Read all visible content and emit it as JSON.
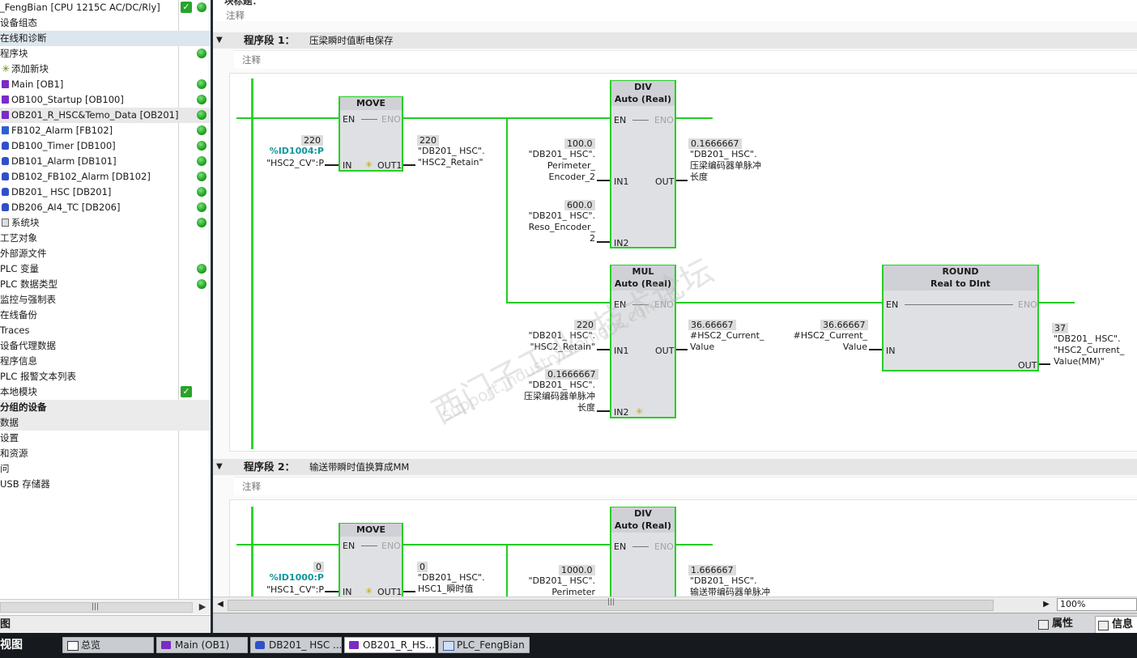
{
  "project_tree": {
    "items": [
      {
        "label": "_FengBian [CPU 1215C AC/DC/Rly]",
        "icon": "none",
        "indent": 0,
        "status": "check-dot"
      },
      {
        "label": "设备组态",
        "icon": "none",
        "indent": 0,
        "status": ""
      },
      {
        "label": "在线和诊断",
        "icon": "none",
        "indent": 0,
        "status": "",
        "selected": true
      },
      {
        "label": "程序块",
        "icon": "none",
        "indent": 0,
        "status": "dot"
      },
      {
        "label": "添加新块",
        "icon": "add",
        "indent": 1,
        "status": ""
      },
      {
        "label": "Main [OB1]",
        "icon": "ob",
        "indent": 1,
        "status": "dot"
      },
      {
        "label": "OB100_Startup [OB100]",
        "icon": "ob",
        "indent": 1,
        "status": "dot"
      },
      {
        "label": "OB201_R_HSC&Temo_Data [OB201]",
        "icon": "ob",
        "indent": 1,
        "status": "dot",
        "hover": true
      },
      {
        "label": "FB102_Alarm [FB102]",
        "icon": "fb",
        "indent": 1,
        "status": "dot"
      },
      {
        "label": "DB100_Timer [DB100]",
        "icon": "db",
        "indent": 1,
        "status": "dot"
      },
      {
        "label": "DB101_Alarm [DB101]",
        "icon": "db",
        "indent": 1,
        "status": "dot"
      },
      {
        "label": "DB102_FB102_Alarm [DB102]",
        "icon": "db",
        "indent": 1,
        "status": "dot"
      },
      {
        "label": "DB201_ HSC [DB201]",
        "icon": "db",
        "indent": 1,
        "status": "dot"
      },
      {
        "label": "DB206_AI4_TC [DB206]",
        "icon": "db",
        "indent": 1,
        "status": "dot"
      },
      {
        "label": "系统块",
        "icon": "sys",
        "indent": 1,
        "status": "dot"
      },
      {
        "label": "工艺对象",
        "icon": "none",
        "indent": 0,
        "status": ""
      },
      {
        "label": "外部源文件",
        "icon": "none",
        "indent": 0,
        "status": ""
      },
      {
        "label": "PLC 变量",
        "icon": "none",
        "indent": 0,
        "status": "dot"
      },
      {
        "label": "PLC 数据类型",
        "icon": "none",
        "indent": 0,
        "status": "dot"
      },
      {
        "label": "监控与强制表",
        "icon": "none",
        "indent": 0,
        "status": ""
      },
      {
        "label": "在线备份",
        "icon": "none",
        "indent": 0,
        "status": ""
      },
      {
        "label": "Traces",
        "icon": "none",
        "indent": 0,
        "status": ""
      },
      {
        "label": "设备代理数据",
        "icon": "none",
        "indent": 0,
        "status": ""
      },
      {
        "label": "程序信息",
        "icon": "none",
        "indent": 0,
        "status": ""
      },
      {
        "label": "PLC 报警文本列表",
        "icon": "none",
        "indent": 0,
        "status": ""
      },
      {
        "label": "本地模块",
        "icon": "none",
        "indent": 0,
        "status": "check"
      },
      {
        "label": "分组的设备",
        "icon": "none",
        "indent": 0,
        "status": "",
        "bold": true,
        "group": true
      },
      {
        "label": "数据",
        "icon": "none",
        "indent": 0,
        "status": "",
        "group": true
      },
      {
        "label": "设置",
        "icon": "none",
        "indent": 0,
        "status": ""
      },
      {
        "label": "和资源",
        "icon": "none",
        "indent": 0,
        "status": ""
      },
      {
        "label": "问",
        "icon": "none",
        "indent": 0,
        "status": ""
      },
      {
        "label": "USB 存储器",
        "icon": "none",
        "indent": 0,
        "status": ""
      }
    ],
    "footer_label": "图"
  },
  "editor": {
    "top_title": "块标题：",
    "top_comment": "注释",
    "segments": [
      {
        "number": "程序段 1：",
        "title": "压梁瞬时值断电保存",
        "comment": "注释"
      },
      {
        "number": "程序段 2：",
        "title": "输送带瞬时值换算成MM",
        "comment": "注释"
      }
    ],
    "watermark": {
      "line1": "西门子工业",
      "line2": "技术论坛",
      "line3": "support.industry.siemens.com/cs"
    }
  },
  "seg1": {
    "move": {
      "name": "MOVE",
      "en": "EN",
      "eno": "ENO",
      "in": "IN",
      "out": "OUT1",
      "in_value": "220",
      "in_addr": "%ID1004:P",
      "in_tag": "\"HSC2_CV\":P",
      "out_value": "220",
      "out_tag_1": "\"DB201_ HSC\".",
      "out_tag_2": "\"HSC2_Retain\""
    },
    "div": {
      "name": "DIV",
      "type": "Auto (Real)",
      "en": "EN",
      "eno": "ENO",
      "in1": "IN1",
      "in2": "IN2",
      "out": "OUT",
      "in1_value": "100.0",
      "in1_tag": "\"DB201_ HSC\".\nPerimeter_\nEncoder_2",
      "in2_value": "600.0",
      "in2_tag": "\"DB201_ HSC\".\nReso_Encoder_\n2",
      "out_value": "0.1666667",
      "out_tag": "\"DB201_ HSC\".\n压梁编码器单脉冲\n长度"
    },
    "mul": {
      "name": "MUL",
      "type": "Auto (Real)",
      "en": "EN",
      "eno": "ENO",
      "in1": "IN1",
      "in2": "IN2",
      "out": "OUT",
      "in1_value": "220",
      "in1_tag": "\"DB201_ HSC\".\n\"HSC2_Retain\"",
      "in2_value": "0.1666667",
      "in2_tag": "\"DB201_ HSC\".\n压梁编码器单脉冲\n长度",
      "out_value": "36.66667",
      "out_tag": "#HSC2_Current_\nValue"
    },
    "round": {
      "name": "ROUND",
      "type": "Real  to  DInt",
      "en": "EN",
      "eno": "ENO",
      "in": "IN",
      "out": "OUT",
      "in_value": "36.66667",
      "in_tag": "#HSC2_Current_\nValue",
      "out_value": "37",
      "out_tag": "\"DB201_ HSC\".\n\"HSC2_Current_\nValue(MM)\""
    }
  },
  "seg2": {
    "move": {
      "name": "MOVE",
      "en": "EN",
      "eno": "ENO",
      "in": "IN",
      "out": "OUT1",
      "in_value": "0",
      "in_addr": "%ID1000:P",
      "in_tag": "\"HSC1_CV\":P",
      "out_value": "0",
      "out_tag_1": "\"DB201_ HSC\".",
      "out_tag_2": "HSC1_瞬时值"
    },
    "div": {
      "name": "DIV",
      "type": "Auto (Real)",
      "en": "EN",
      "eno": "ENO",
      "in1_value": "1000.0",
      "in1_tag": "\"DB201_ HSC\".\nPerimeter",
      "out_value": "1.666667",
      "out_tag": "\"DB201_ HSC\".\n输送带编码器单脉冲"
    }
  },
  "statusbar": {
    "zoom": "100%",
    "tab_properties": "属性",
    "tab_info": "信息"
  },
  "taskbar": {
    "portal_label": "视图",
    "tasks": [
      {
        "label": "总览",
        "icon": "overview-icon"
      },
      {
        "label": "Main (OB1)",
        "icon": "ob-icon"
      },
      {
        "label": "DB201_ HSC ...",
        "icon": "db-icon"
      },
      {
        "label": "OB201_R_HS...",
        "icon": "ob-icon",
        "active": true
      },
      {
        "label": "PLC_FengBian",
        "icon": "device-icon"
      }
    ]
  },
  "colors": {
    "rung": "#22cc22",
    "box_border": "#26cf26",
    "address": "#11979e",
    "taskbar": "#16191d"
  }
}
